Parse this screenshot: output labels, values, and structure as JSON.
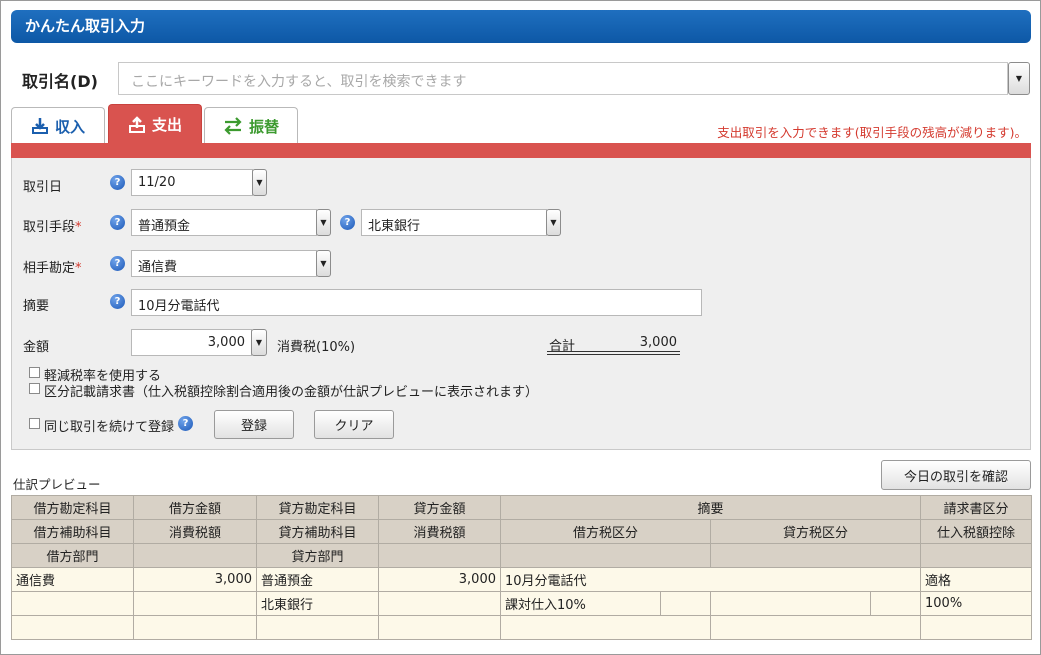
{
  "window": {
    "title": "かんたん取引入力"
  },
  "search": {
    "label": "取引名(D)",
    "placeholder": "ここにキーワードを入力すると、取引を検索できます"
  },
  "tabs": [
    {
      "label": "収入",
      "active": false,
      "icon": "download-icon"
    },
    {
      "label": "支出",
      "active": true,
      "icon": "upload-icon"
    },
    {
      "label": "振替",
      "active": false,
      "icon": "transfer-arrows-icon"
    }
  ],
  "notice": "支出取引を入力できます(取引手段の残高が減ります)。",
  "form": {
    "date": {
      "label": "取引日",
      "value": "11/20"
    },
    "method": {
      "label": "取引手段",
      "required_mark": "*",
      "value": "普通預金",
      "sub_value": "北東銀行"
    },
    "account": {
      "label": "相手勘定",
      "required_mark": "*",
      "value": "通信費"
    },
    "memo": {
      "label": "摘要",
      "value": "10月分電話代"
    },
    "amount": {
      "label": "金額",
      "value": "3,000",
      "tax_label": "消費税(10%)",
      "total_label": "合計",
      "total_value": "3,000"
    },
    "reduced_tax_label": "軽減税率を使用する",
    "invoice_label": "区分記載請求書（仕入税額控除割合適用後の金額が仕訳プレビューに表示されます）",
    "repeat_label": "同じ取引を続けて登録",
    "register_button": "登録",
    "clear_button": "クリア"
  },
  "preview": {
    "title": "仕訳プレビュー",
    "today_button": "今日の取引を確認",
    "header_row1": [
      "借方勘定科目",
      "借方金額",
      "貸方勘定科目",
      "貸方金額",
      "摘要",
      "請求書区分"
    ],
    "header_row2": [
      "借方補助科目",
      "消費税額",
      "貸方補助科目",
      "消費税額",
      "借方税区分",
      "貸方税区分",
      "仕入税額控除"
    ],
    "header_row3": [
      "借方部門",
      "",
      "貸方部門",
      "",
      "",
      "",
      ""
    ],
    "rows": [
      [
        "通信費",
        "3,000",
        "普通預金",
        "3,000",
        "10月分電話代",
        "適格"
      ],
      [
        "",
        "",
        "北東銀行",
        "",
        "課対仕入10%",
        "",
        "",
        "",
        "100%"
      ],
      [
        "",
        "",
        "",
        "",
        "",
        "",
        ""
      ]
    ]
  },
  "colors": {
    "title_bar": "#0d58a6",
    "expense_tab": "#d9534f",
    "notice_text": "#d43a2f",
    "table_header": "#d8d1c6",
    "table_body": "#fdf9e9"
  }
}
